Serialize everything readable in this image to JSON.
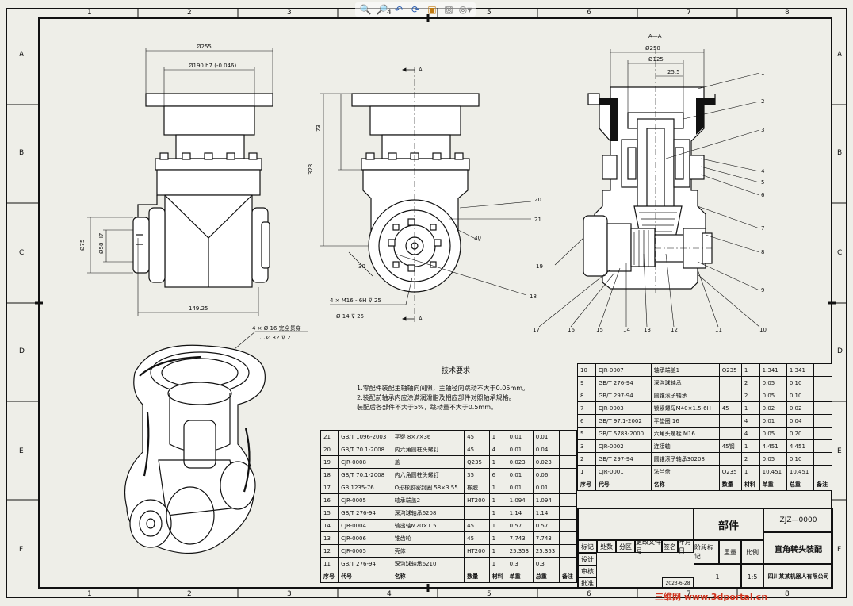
{
  "toolbar": {
    "icons": [
      "zoom-to-fit-icon",
      "zoom-area-icon",
      "previous-view-icon",
      "rotate-icon",
      "section-view-icon",
      "display-style-icon",
      "hide-show-icon"
    ]
  },
  "zones": {
    "columns": [
      "1",
      "2",
      "3",
      "4",
      "5",
      "6",
      "7",
      "8"
    ],
    "rows": [
      "A",
      "B",
      "C",
      "D",
      "E",
      "F"
    ]
  },
  "dims": {
    "front": {
      "d255": "Ø255",
      "d190": "Ø190 h7 (-0.046)",
      "d75": "Ø75",
      "d58": "Ø58 H7",
      "w149": "149.25"
    },
    "side": {
      "h73": "73",
      "h323": "323",
      "hole_note": "4 × M16 - 6H ⊽ 25",
      "hole_note2": "Ø 14 ⊽ 25",
      "a30": "30",
      "a50": "30",
      "sec": "A"
    },
    "section": {
      "title": "A—A",
      "d250": "Ø250",
      "d125": "Ø125",
      "d255": "25.5"
    },
    "iso_note1": "4 × Ø 16 完全贯穿",
    "iso_note2": "⌴ Ø 32 ⊽ 2"
  },
  "callouts_right": [
    "1",
    "2",
    "3",
    "4",
    "5",
    "6",
    "7",
    "8",
    "9",
    "10"
  ],
  "callouts_bottom": [
    "17",
    "16",
    "15",
    "14",
    "13",
    "12",
    "11"
  ],
  "callouts_left": [
    "20",
    "21",
    "19",
    "18"
  ],
  "notes": {
    "title": "技术要求",
    "lines": [
      "1.零配件装配主轴轴向间隙，主轴径向跳动不大于0.05mm。",
      "2.装配前轴承内应涂满润滑脂及相应部件对照轴承规格。",
      "装配后各部件不大于5%，跳动量不大于0.5mm。"
    ]
  },
  "bom_right": {
    "rows": [
      [
        "10",
        "CJR-0007",
        "轴承端盖1",
        "Q235",
        "1",
        "1.341",
        "1.341"
      ],
      [
        "9",
        "GB/T 276-94",
        "深沟球轴承",
        "",
        "2",
        "0.05",
        "0.10"
      ],
      [
        "8",
        "GB/T 297-94",
        "圆锥滚子轴承",
        "",
        "2",
        "0.05",
        "0.10"
      ],
      [
        "7",
        "CJR-0003",
        "锁紧螺母M40×1.5-6H",
        "45",
        "1",
        "0.02",
        "0.02"
      ],
      [
        "6",
        "GB/T 97.1-2002",
        "平垫圈 16",
        "",
        "4",
        "0.01",
        "0.04"
      ],
      [
        "5",
        "GB/T 5783-2000",
        "六角头螺栓 M16",
        "",
        "4",
        "0.05",
        "0.20"
      ],
      [
        "3",
        "CJR-0002",
        "连接轴",
        "45钢",
        "1",
        "4.451",
        "4.451"
      ],
      [
        "2",
        "GB/T 297-94",
        "圆锥滚子轴承30208",
        "",
        "2",
        "0.05",
        "0.10"
      ],
      [
        "1",
        "CJR-0001",
        "法兰盘",
        "Q235",
        "1",
        "10.451",
        "10.451"
      ]
    ],
    "header": [
      "序号",
      "代号",
      "名称",
      "数量",
      "材料",
      "单重",
      "总重",
      "备注"
    ]
  },
  "bom_left": {
    "rows": [
      [
        "21",
        "GB/T 1096-2003",
        "平键 8×7×36",
        "45",
        "1",
        "0.01",
        "0.01"
      ],
      [
        "20",
        "GB/T 70.1-2008",
        "内六角圆柱头螺钉",
        "45",
        "4",
        "0.01",
        "0.04"
      ],
      [
        "19",
        "CJR-0008",
        "盖",
        "Q235",
        "1",
        "0.023",
        "0.023"
      ],
      [
        "18",
        "GB/T 70.1-2008",
        "内六角圆柱头螺钉",
        "35",
        "6",
        "0.01",
        "0.06"
      ],
      [
        "17",
        "GB 1235-76",
        "O形橡胶密封圈 58×3.55",
        "橡胶",
        "1",
        "0.01",
        "0.01"
      ],
      [
        "16",
        "CJR-0005",
        "轴承端盖2",
        "HT200",
        "1",
        "1.094",
        "1.094"
      ],
      [
        "15",
        "GB/T 276-94",
        "深沟球轴承6208",
        "",
        "1",
        "1.14",
        "1.14"
      ],
      [
        "14",
        "CJR-0004",
        "输出轴M20×1.5",
        "45",
        "1",
        "0.57",
        "0.57"
      ],
      [
        "13",
        "CJR-0006",
        "锥齿轮",
        "45",
        "1",
        "7.743",
        "7.743"
      ],
      [
        "12",
        "CJR-0005",
        "壳体",
        "HT200",
        "1",
        "25.353",
        "25.353"
      ],
      [
        "11",
        "GB/T 276-94",
        "深沟球轴承6210",
        "",
        "1",
        "0.3",
        "0.3"
      ]
    ],
    "header": [
      "序号",
      "代号",
      "名称",
      "数量",
      "材料",
      "单重",
      "总重",
      "备注"
    ]
  },
  "title_block": {
    "part_label": "部件",
    "drawing_no": "ZJZ—0000",
    "drawing_name": "直角转头装配",
    "company": "四川某某机器人有限公司",
    "scale": "1:5",
    "sheet": "1",
    "date": "2023-6-28",
    "rows_label": [
      "标记",
      "处数",
      "分区",
      "更改文件号",
      "签名",
      "年月日"
    ],
    "roles": [
      "设计",
      "审核",
      "工艺",
      "批准"
    ],
    "stage": "阶段标记",
    "weight": "重量",
    "ratio": "比例"
  },
  "watermark": "三维网 www.3dportal.cn"
}
